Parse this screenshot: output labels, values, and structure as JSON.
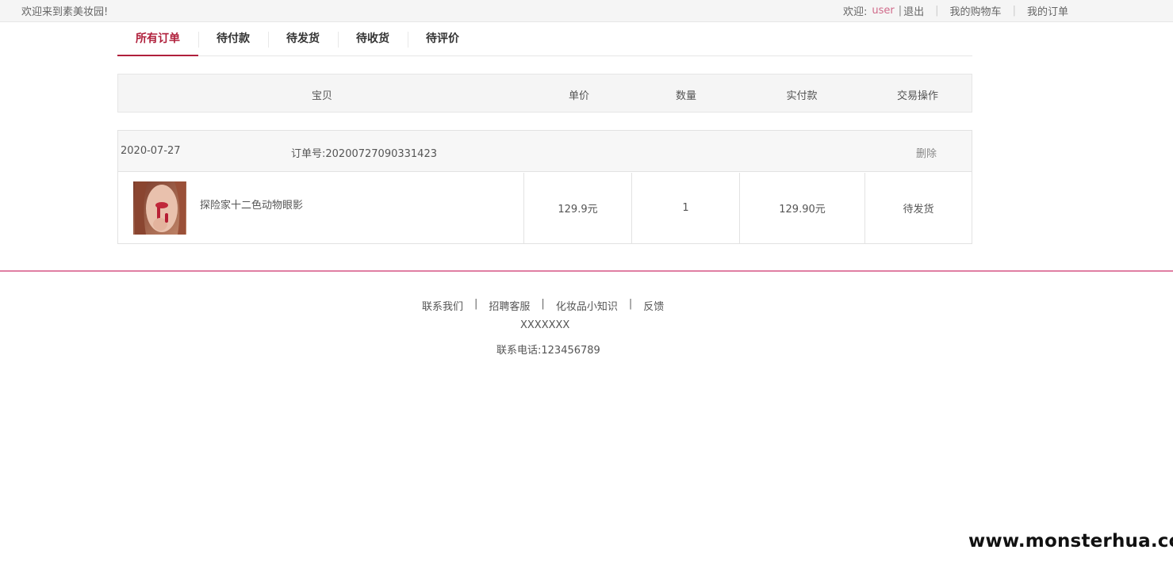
{
  "topbar": {
    "welcome": "欢迎来到素美妆园!",
    "greeting": "欢迎:",
    "username": "user",
    "bar": "|",
    "logout": "退出",
    "cart": "我的购物车",
    "orders": "我的订单",
    "divider": "|"
  },
  "tabs": [
    {
      "label": "所有订单"
    },
    {
      "label": "待付款"
    },
    {
      "label": "待发货"
    },
    {
      "label": "待收货"
    },
    {
      "label": "待评价"
    }
  ],
  "table_header": {
    "item": "宝贝",
    "unit_price": "单价",
    "quantity": "数量",
    "paid": "实付款",
    "action": "交易操作"
  },
  "order": {
    "date": "2020-07-27",
    "order_no": "订单号:20200727090331423",
    "delete": "删除",
    "product_name": "探险家十二色动物眼影",
    "unit_price": "129.9元",
    "quantity": "1",
    "paid": "129.90元",
    "status": "待发货"
  },
  "footer": {
    "links": [
      "联系我们",
      "招聘客服",
      "化妆品小知识",
      "反馈"
    ],
    "pipe": "|",
    "company": "XXXXXXX",
    "phone": "联系电话:123456789"
  },
  "watermark": "www.monsterhua.com",
  "colors": {
    "accent": "#b0203c",
    "username": "#d06a8a",
    "footer_line": "#e07fa3"
  }
}
